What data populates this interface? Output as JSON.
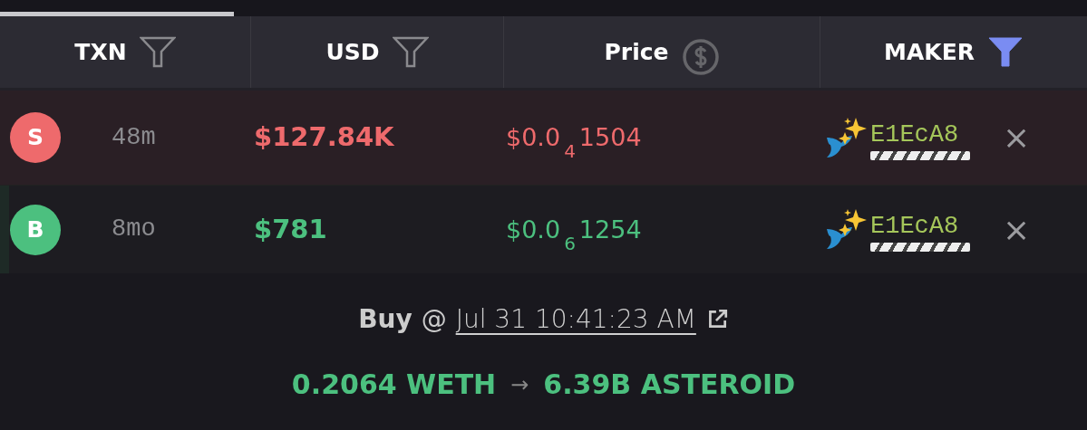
{
  "progress": {
    "level": 0.215
  },
  "columns": [
    {
      "label": "TXN",
      "kind": "filter",
      "active": false
    },
    {
      "label": "USD",
      "kind": "filter",
      "active": false
    },
    {
      "label": "Price",
      "kind": "currency",
      "active": false
    },
    {
      "label": "MAKER",
      "kind": "filter",
      "active": true
    }
  ],
  "rows": [
    {
      "kind": "sell",
      "badge": "S",
      "age": "48m",
      "usd": "$127.84K",
      "price": "$0.0$_{4}$1504",
      "maker": "E1EcA8",
      "close": "×"
    },
    {
      "kind": "buy",
      "badge": "B",
      "age": "8mo",
      "usd": "$781",
      "price": "$0.0$_{6}$1254",
      "maker": "E1EcA8",
      "close": "×"
    }
  ],
  "detail": {
    "side": "Buy",
    "at": "@",
    "time": "Jul 31 10:41:23 AM",
    "amount_in": "0.2064 WETH",
    "arrow": "→",
    "amount_out": "6.39B ASTEROID"
  }
}
